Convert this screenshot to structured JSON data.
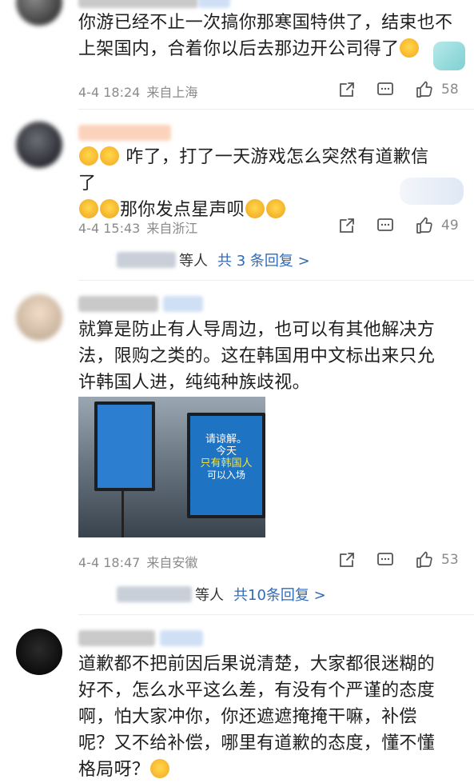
{
  "comments": [
    {
      "text": "你游已经不止一次搞你那寒国特供了，结束也不上架国内，合着你以后去那边开公司得了",
      "date": "4-4 18:24",
      "location": "来自上海",
      "likes": "58"
    },
    {
      "text_line1": "咋了，打了一天游戏怎么突然有道歉信了",
      "text_line2": "那你发点星声呗",
      "date": "4-4 15:43",
      "location": "来自浙江",
      "likes": "49",
      "reply_suffix": "等人",
      "reply_link": "共 3 条回复 >"
    },
    {
      "text": "就算是防止有人导周边，也可以有其他解决方法，限购之类的。这在韩国用中文标出来只允许韩国人进，纯纯种族歧视。",
      "date": "4-4 18:47",
      "location": "来自安徽",
      "likes": "53",
      "reply_suffix": "等人",
      "reply_link": "共10条回复 >",
      "image_sign": {
        "line1": "请谅解。",
        "line2": "今天",
        "line3": "只有韩国人",
        "line4": "可以入场"
      }
    },
    {
      "text": "道歉都不把前因后果说清楚，大家都很迷糊的好不，怎么水平这么差，有没有个严谨的态度啊，怕大家冲你，你还遮遮掩掩干嘛，补偿呢？又不给补偿，哪里有道歉的态度，懂不懂格局呀？"
    }
  ],
  "colors": {
    "link": "#2e6bb8",
    "meta": "#8a8a8a",
    "name_highlight": "#fbd3bd",
    "sign_blue": "#1e73c2",
    "sign_yellow": "#f7e33b"
  },
  "icons": [
    "share-icon",
    "comment-icon",
    "like-icon"
  ]
}
